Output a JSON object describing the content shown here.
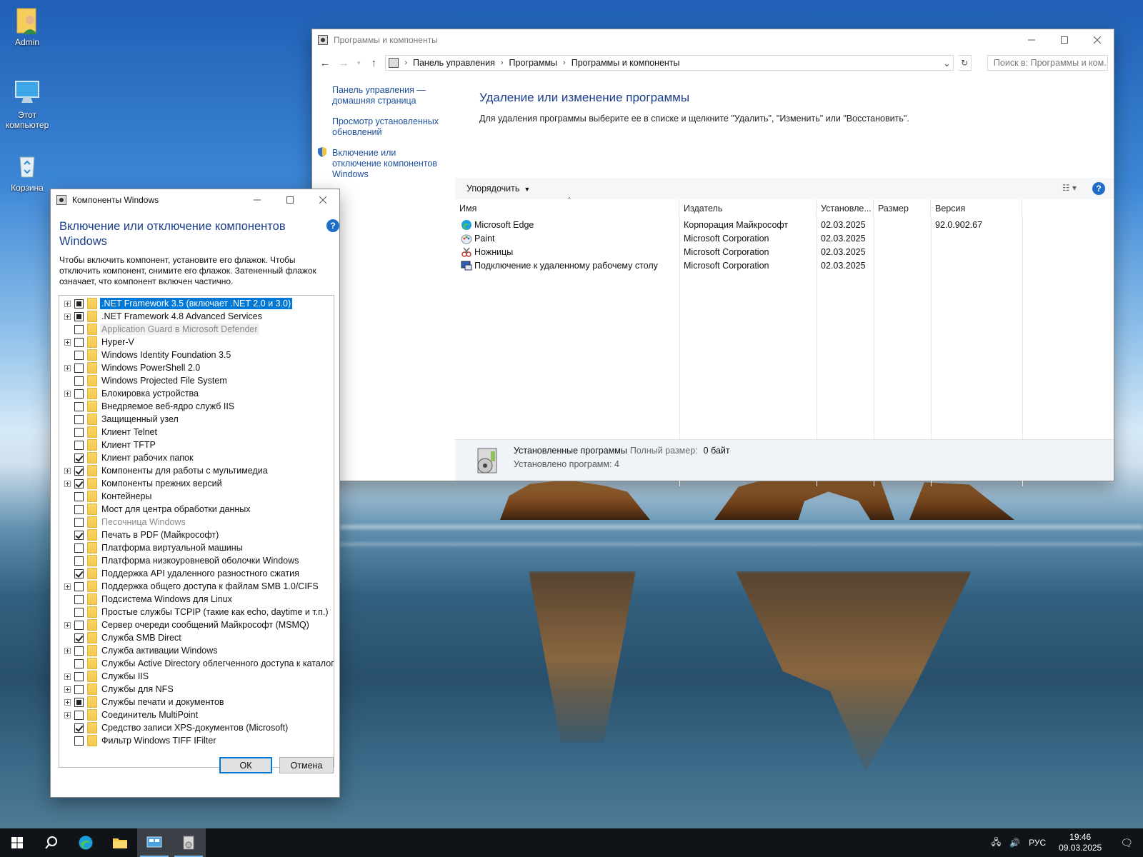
{
  "desktop": {
    "icons": [
      {
        "label": "Admin",
        "icon": "user-folder-icon"
      },
      {
        "label": "Этот компьютер",
        "icon": "computer-icon"
      },
      {
        "label": "Корзина",
        "icon": "recycle-bin-icon"
      }
    ]
  },
  "programs_window": {
    "title": "Программы и компоненты",
    "address": {
      "crumbs": [
        "Панель управления",
        "Программы",
        "Программы и компоненты"
      ]
    },
    "search_placeholder": "Поиск в: Программы и ком...",
    "left_links": [
      "Панель управления — домашняя страница",
      "Просмотр установленных обновлений",
      "Включение или отключение компонентов Windows"
    ],
    "heading": "Удаление или изменение программы",
    "description": "Для удаления программы выберите ее в списке и щелкните \"Удалить\", \"Изменить\" или \"Восстановить\".",
    "organize_label": "Упорядочить",
    "columns": [
      "Имя",
      "Издатель",
      "Установле...",
      "Размер",
      "Версия"
    ],
    "rows": [
      {
        "name": "Microsoft Edge",
        "publisher": "Корпорация Майкрософт",
        "installed": "02.03.2025",
        "size": "",
        "version": "92.0.902.67",
        "icon": "edge-icon"
      },
      {
        "name": "Paint",
        "publisher": "Microsoft Corporation",
        "installed": "02.03.2025",
        "size": "",
        "version": "",
        "icon": "paint-icon"
      },
      {
        "name": "Ножницы",
        "publisher": "Microsoft Corporation",
        "installed": "02.03.2025",
        "size": "",
        "version": "",
        "icon": "snipping-icon"
      },
      {
        "name": "Подключение к удаленному рабочему столу",
        "publisher": "Microsoft Corporation",
        "installed": "02.03.2025",
        "size": "",
        "version": "",
        "icon": "remote-desktop-icon"
      }
    ],
    "status": {
      "title": "Установленные программы",
      "total_label": "Полный размер:",
      "total_value": "0 байт",
      "count_text": "Установлено программ: 4"
    }
  },
  "components_window": {
    "title": "Компоненты Windows",
    "heading": "Включение или отключение компонентов Windows",
    "description": "Чтобы включить компонент, установите его флажок. Чтобы отключить компонент, снимите его флажок. Затененный флажок означает, что компонент включен частично.",
    "items": [
      {
        "label": ".NET Framework 3.5 (включает .NET 2.0 и 3.0)",
        "state": "partial",
        "expandable": true,
        "selected": true,
        "disabled": false
      },
      {
        "label": ".NET Framework 4.8 Advanced Services",
        "state": "partial",
        "expandable": true,
        "selected": false,
        "disabled": false
      },
      {
        "label": "Application Guard в Microsoft Defender",
        "state": "unchecked",
        "expandable": false,
        "selected": false,
        "disabled": true
      },
      {
        "label": "Hyper-V",
        "state": "unchecked",
        "expandable": true,
        "selected": false,
        "disabled": false
      },
      {
        "label": "Windows Identity Foundation 3.5",
        "state": "unchecked",
        "expandable": false,
        "selected": false,
        "disabled": false
      },
      {
        "label": "Windows PowerShell 2.0",
        "state": "unchecked",
        "expandable": true,
        "selected": false,
        "disabled": false
      },
      {
        "label": "Windows Projected File System",
        "state": "unchecked",
        "expandable": false,
        "selected": false,
        "disabled": false
      },
      {
        "label": "Блокировка устройства",
        "state": "unchecked",
        "expandable": true,
        "selected": false,
        "disabled": false
      },
      {
        "label": "Внедряемое веб-ядро служб IIS",
        "state": "unchecked",
        "expandable": false,
        "selected": false,
        "disabled": false
      },
      {
        "label": "Защищенный узел",
        "state": "unchecked",
        "expandable": false,
        "selected": false,
        "disabled": false
      },
      {
        "label": "Клиент Telnet",
        "state": "unchecked",
        "expandable": false,
        "selected": false,
        "disabled": false
      },
      {
        "label": "Клиент TFTP",
        "state": "unchecked",
        "expandable": false,
        "selected": false,
        "disabled": false
      },
      {
        "label": "Клиент рабочих папок",
        "state": "checked",
        "expandable": false,
        "selected": false,
        "disabled": false
      },
      {
        "label": "Компоненты для работы с мультимедиа",
        "state": "checked",
        "expandable": true,
        "selected": false,
        "disabled": false
      },
      {
        "label": "Компоненты прежних версий",
        "state": "checked",
        "expandable": true,
        "selected": false,
        "disabled": false
      },
      {
        "label": "Контейнеры",
        "state": "unchecked",
        "expandable": false,
        "selected": false,
        "disabled": false
      },
      {
        "label": "Мост для центра обработки данных",
        "state": "unchecked",
        "expandable": false,
        "selected": false,
        "disabled": false
      },
      {
        "label": "Песочница Windows",
        "state": "unchecked",
        "expandable": false,
        "selected": false,
        "disabled": true
      },
      {
        "label": "Печать в PDF (Майкрософт)",
        "state": "checked",
        "expandable": false,
        "selected": false,
        "disabled": false
      },
      {
        "label": "Платформа виртуальной машины",
        "state": "unchecked",
        "expandable": false,
        "selected": false,
        "disabled": false
      },
      {
        "label": "Платформа низкоуровневой оболочки Windows",
        "state": "unchecked",
        "expandable": false,
        "selected": false,
        "disabled": false
      },
      {
        "label": "Поддержка API удаленного разностного сжатия",
        "state": "checked",
        "expandable": false,
        "selected": false,
        "disabled": false
      },
      {
        "label": "Поддержка общего доступа к файлам SMB 1.0/CIFS",
        "state": "unchecked",
        "expandable": true,
        "selected": false,
        "disabled": false
      },
      {
        "label": "Подсистема Windows для Linux",
        "state": "unchecked",
        "expandable": false,
        "selected": false,
        "disabled": false
      },
      {
        "label": "Простые службы TCPIP (такие как echo, daytime и т.п.)",
        "state": "unchecked",
        "expandable": false,
        "selected": false,
        "disabled": false
      },
      {
        "label": "Сервер очереди сообщений Майкрософт (MSMQ)",
        "state": "unchecked",
        "expandable": true,
        "selected": false,
        "disabled": false
      },
      {
        "label": "Служба SMB Direct",
        "state": "checked",
        "expandable": false,
        "selected": false,
        "disabled": false
      },
      {
        "label": "Служба активации Windows",
        "state": "unchecked",
        "expandable": true,
        "selected": false,
        "disabled": false
      },
      {
        "label": "Службы Active Directory облегченного доступа к каталогам",
        "state": "unchecked",
        "expandable": false,
        "selected": false,
        "disabled": false
      },
      {
        "label": "Службы IIS",
        "state": "unchecked",
        "expandable": true,
        "selected": false,
        "disabled": false
      },
      {
        "label": "Службы для NFS",
        "state": "unchecked",
        "expandable": true,
        "selected": false,
        "disabled": false
      },
      {
        "label": "Службы печати и документов",
        "state": "partial",
        "expandable": true,
        "selected": false,
        "disabled": false
      },
      {
        "label": "Соединитель MultiPoint",
        "state": "unchecked",
        "expandable": true,
        "selected": false,
        "disabled": false
      },
      {
        "label": "Средство записи XPS-документов (Microsoft)",
        "state": "checked",
        "expandable": false,
        "selected": false,
        "disabled": false
      },
      {
        "label": "Фильтр Windows TIFF IFilter",
        "state": "unchecked",
        "expandable": false,
        "selected": false,
        "disabled": false
      }
    ],
    "ok_label": "ОК",
    "cancel_label": "Отмена"
  },
  "taskbar": {
    "items": [
      "start-icon",
      "search-icon",
      "edge-icon",
      "file-explorer-icon",
      "control-panel-icon",
      "components-icon"
    ],
    "language": "РУС",
    "time": "19:46",
    "date": "09.03.2025"
  }
}
